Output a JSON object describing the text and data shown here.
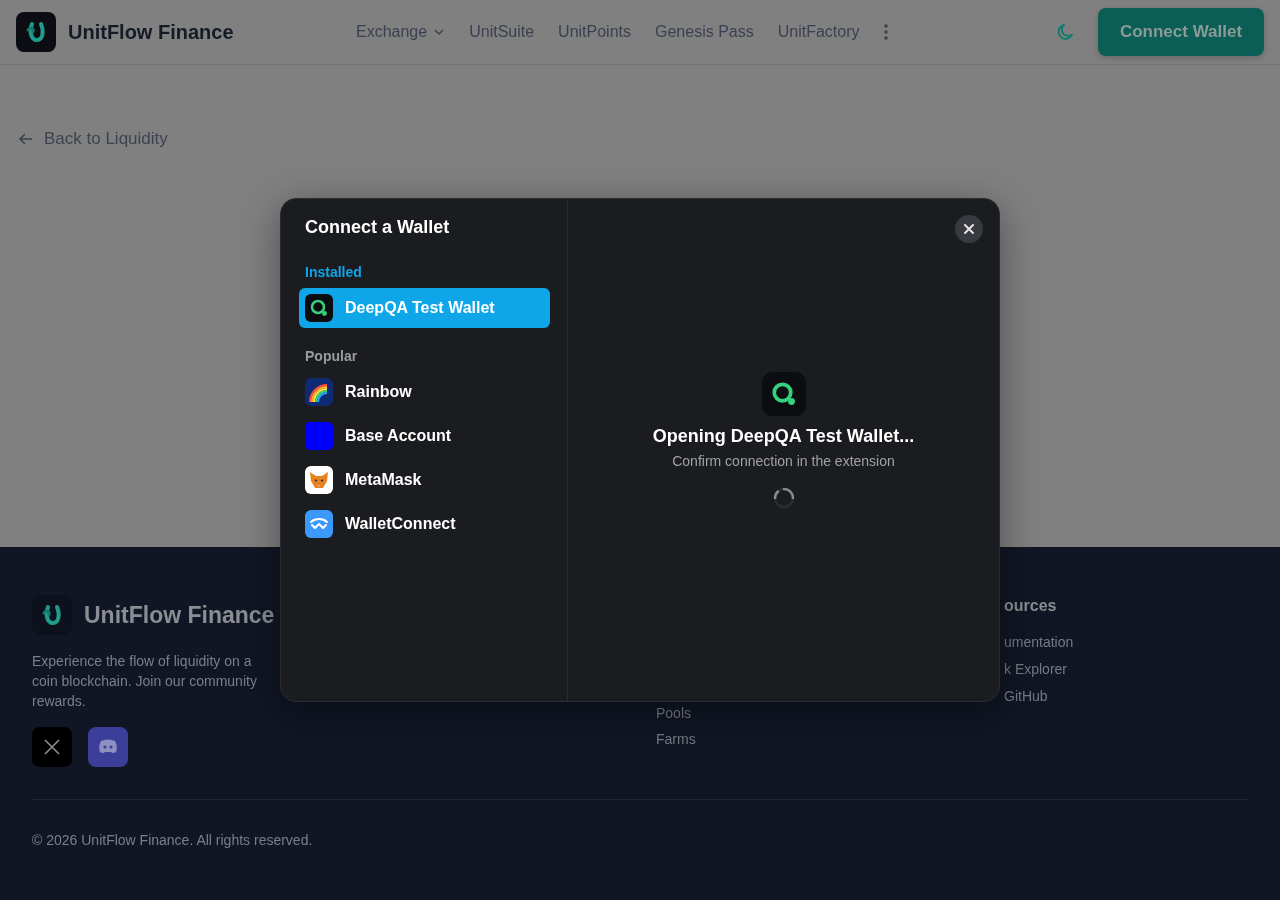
{
  "header": {
    "brand": "UnitFlow Finance",
    "nav": [
      {
        "label": "Exchange",
        "kind": "dropdown"
      },
      {
        "label": "UnitSuite",
        "kind": "link"
      },
      {
        "label": "UnitPoints",
        "kind": "link"
      },
      {
        "label": "Genesis Pass",
        "kind": "link"
      },
      {
        "label": "UnitFactory",
        "kind": "link"
      }
    ],
    "connect_button": "Connect Wallet"
  },
  "back_link": "Back to Liquidity",
  "footer": {
    "brand": "UnitFlow Finance",
    "description_lines": [
      "Experience the flow of liquidity on a",
      "coin blockchain. Join our community",
      "rewards."
    ],
    "middle_links": [
      "Pools",
      "Farms"
    ],
    "resources": {
      "heading": "ources",
      "links": [
        "umentation",
        "k Explorer",
        "GitHub"
      ]
    },
    "copyright": "© 2026 UnitFlow Finance. All rights reserved."
  },
  "modal": {
    "title": "Connect a Wallet",
    "groups": [
      {
        "label": "Installed",
        "kind": "installed",
        "wallets": [
          {
            "name": "DeepQA Test Wallet",
            "kind": "deepqa",
            "selected": true
          }
        ]
      },
      {
        "label": "Popular",
        "kind": "popular",
        "wallets": [
          {
            "name": "Rainbow",
            "kind": "rainbow",
            "selected": false
          },
          {
            "name": "Base Account",
            "kind": "base",
            "selected": false
          },
          {
            "name": "MetaMask",
            "kind": "metamask",
            "selected": false
          },
          {
            "name": "WalletConnect",
            "kind": "walletconnect",
            "selected": false
          }
        ]
      }
    ],
    "status_title": "Opening DeepQA Test Wallet...",
    "status_text": "Confirm connection in the extension"
  }
}
